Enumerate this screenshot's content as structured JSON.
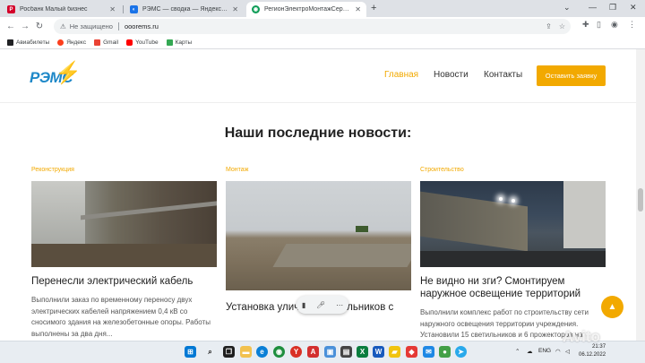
{
  "browser": {
    "tabs": [
      {
        "title": "Росбанк Малый бизнес",
        "favicon_color": "#d4002a",
        "favicon_glyph": "Р"
      },
      {
        "title": "РЭМС — сводка — Яндекс.Мет",
        "favicon_color": "#1a73e8",
        "favicon_glyph": "◐"
      },
      {
        "title": "РегионЭлектроМонтажСервис",
        "favicon_color": "#0f9d58",
        "favicon_glyph": "◉"
      }
    ],
    "new_tab_icon": "+",
    "omnibox": {
      "security_label": "Не защищено",
      "url": "ooorems.ru"
    },
    "bookmarks": [
      {
        "label": "Авиабилеты",
        "icon_color": "#202124"
      },
      {
        "label": "Яндекс",
        "icon_color": "#fc3f1d"
      },
      {
        "label": "Gmail",
        "icon_color": "#ea4335"
      },
      {
        "label": "YouTube",
        "icon_color": "#ff0000"
      },
      {
        "label": "Карты",
        "icon_color": "#34a853"
      }
    ]
  },
  "site": {
    "logo_text": "РЭМС",
    "nav": [
      {
        "label": "Главная",
        "active": true
      },
      {
        "label": "Новости",
        "active": false
      },
      {
        "label": "Контакты",
        "active": false
      }
    ],
    "cta_label": "Оставить заявку",
    "section_title": "Наши последние новости:",
    "accent_color": "#f2a900",
    "cards": [
      {
        "category": "Реконструкция",
        "title": "Перенесли электрический кабель",
        "description": "Выполнили заказ по временному переносу двух электрических кабелей напряжением 0,4 кВ со сносимого здания на железобетонные опоры. Работы выполнены за два дня..."
      },
      {
        "category": "Монтаж",
        "title": "Установка уличных светильников с",
        "description": ""
      },
      {
        "category": "Строительство",
        "title": "Не видно ни зги? Смонтируем наружное освещение территорий",
        "description": "Выполнили комплекс работ по строительству сети наружного освещения территории учреждения. Установили 15 светильников и 6 прожекторов на"
      }
    ]
  },
  "taskbar": {
    "language": "ENG",
    "time": "21:37",
    "date": "06.12.2022"
  },
  "watermark": "Avito"
}
